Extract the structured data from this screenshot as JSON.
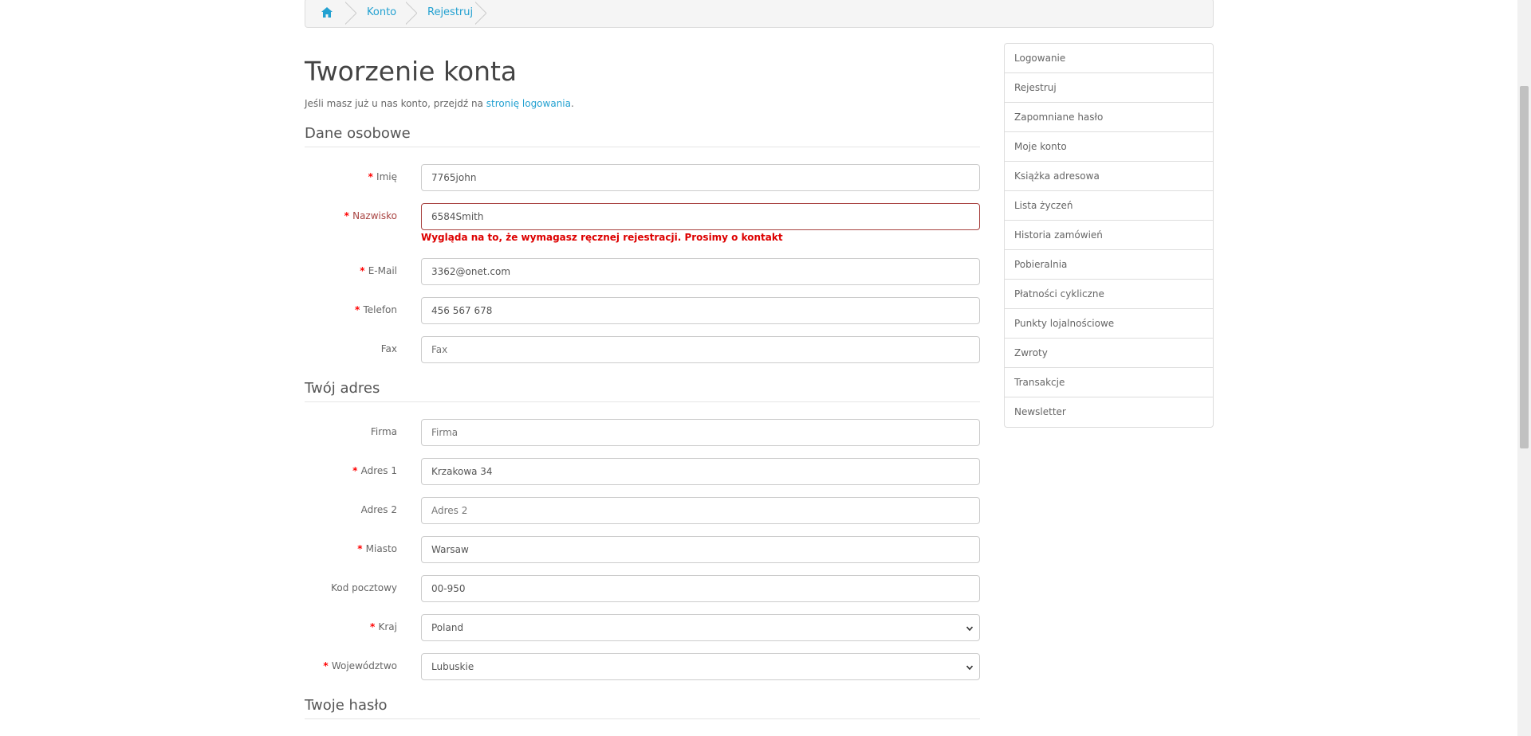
{
  "breadcrumb": {
    "home_icon": "home-icon",
    "items": [
      "Konto",
      "Rejestruj"
    ]
  },
  "page": {
    "title": "Tworzenie konta",
    "intro_prefix": "Jeśli masz już u nas konto, przejdź na ",
    "intro_link": "stronię logowania",
    "intro_suffix": "."
  },
  "sections": {
    "personal": "Dane osobowe",
    "address": "Twój adres",
    "password": "Twoje hasło"
  },
  "personal_fields": {
    "firstname": {
      "label": "Imię",
      "value": "7765john"
    },
    "lastname": {
      "label": "Nazwisko",
      "value": "6584Smith",
      "error": "Wygląda na to, że wymagasz ręcznej rejestracji. Prosimy o kontakt"
    },
    "email": {
      "label": "E-Mail",
      "value": "3362@onet.com"
    },
    "telephone": {
      "label": "Telefon",
      "value": "456 567 678"
    },
    "fax": {
      "label": "Fax",
      "placeholder": "Fax"
    }
  },
  "address_fields": {
    "company": {
      "label": "Firma",
      "placeholder": "Firma"
    },
    "address1": {
      "label": "Adres 1",
      "value": "Krzakowa 34"
    },
    "address2": {
      "label": "Adres 2",
      "placeholder": "Adres 2"
    },
    "city": {
      "label": "Miasto",
      "value": "Warsaw"
    },
    "postcode": {
      "label": "Kod pocztowy",
      "value": "00-950"
    },
    "country": {
      "label": "Kraj",
      "value": "Poland"
    },
    "zone": {
      "label": "Województwo",
      "value": "Lubuskie"
    }
  },
  "sidebar": {
    "items": [
      {
        "label": "Logowanie"
      },
      {
        "label": "Rejestruj"
      },
      {
        "label": "Zapomniane hasło"
      },
      {
        "label": "Moje konto"
      },
      {
        "label": "Książka adresowa"
      },
      {
        "label": "Lista życzeń"
      },
      {
        "label": "Historia zamówień"
      },
      {
        "label": "Pobieralnia"
      },
      {
        "label": "Płatności cykliczne"
      },
      {
        "label": "Punkty lojalnościowe"
      },
      {
        "label": "Zwroty"
      },
      {
        "label": "Transakcje"
      },
      {
        "label": "Newsletter"
      }
    ]
  },
  "colors": {
    "link": "#23a1d1",
    "error": "#a94442",
    "required": "#ff0000"
  }
}
